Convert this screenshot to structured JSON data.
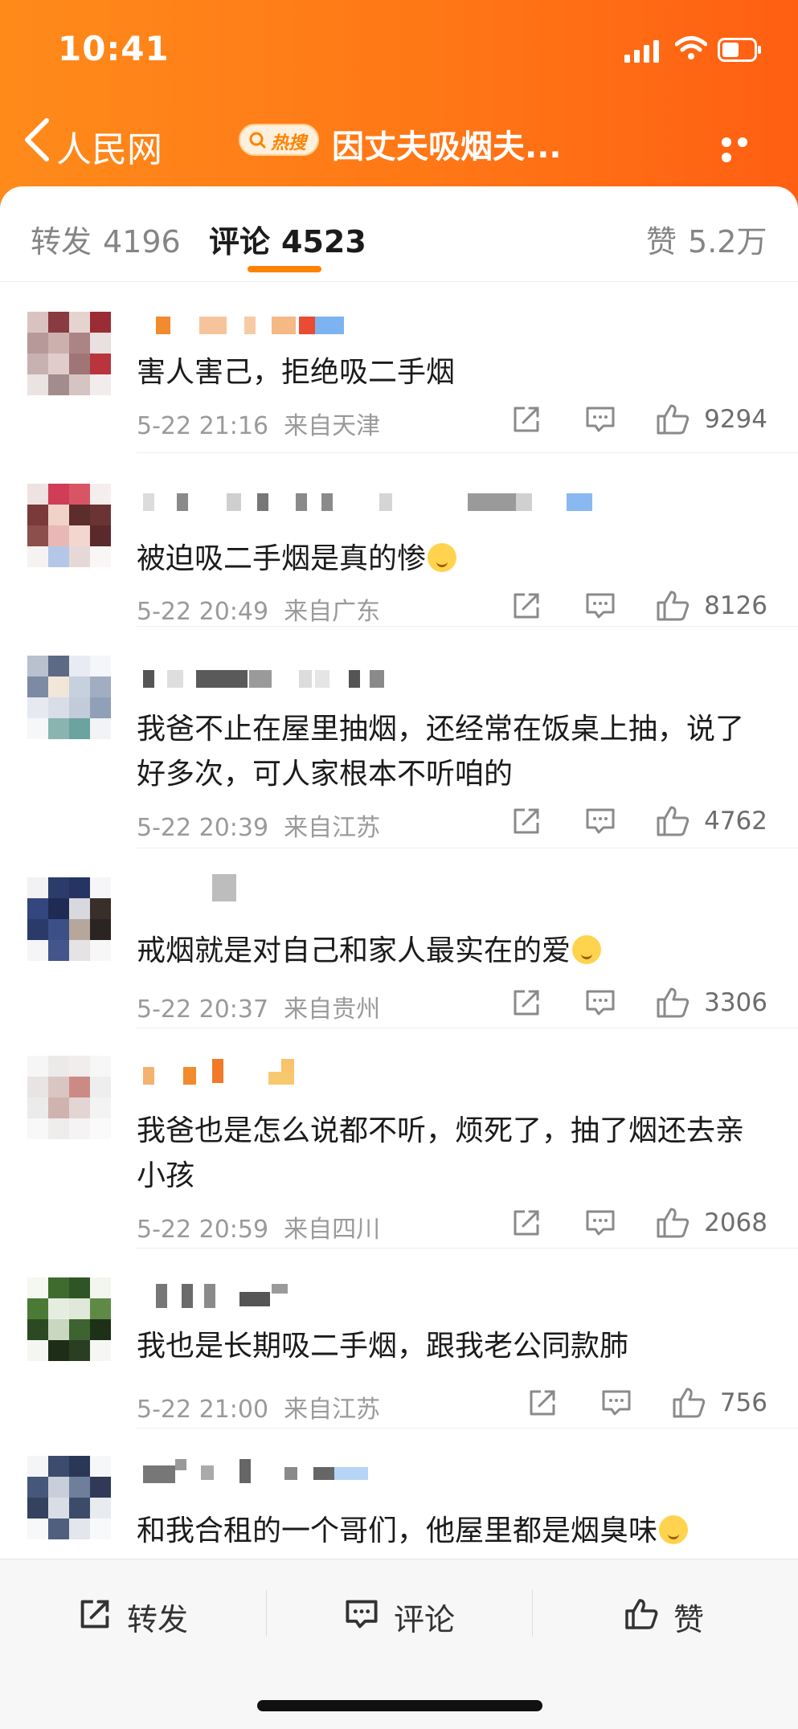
{
  "status": {
    "time": "10:41"
  },
  "nav": {
    "back_label": "人民网",
    "hot_label": "热搜",
    "title": "因丈夫吸烟夫..."
  },
  "tabs": [
    {
      "label": "转发",
      "count": "4196"
    },
    {
      "label": "评论",
      "count": "4523"
    },
    {
      "label": "赞",
      "count": "5.2万"
    }
  ],
  "comments": [
    {
      "text": "害人害己，拒绝吸二手烟",
      "time": "5-22 21:16",
      "location": "来自天津",
      "likes": "9294"
    },
    {
      "text": "被迫吸二手烟是真的惨",
      "emoji": "pensive-face-icon",
      "time": "5-22 20:49",
      "location": "来自广东",
      "likes": "8126"
    },
    {
      "text": "我爸不止在屋里抽烟，还经常在饭桌上抽，说了好多次，可人家根本不听咱的",
      "time": "5-22 20:39",
      "location": "来自江苏",
      "likes": "4762"
    },
    {
      "text": "戒烟就是对自己和家人最实在的爱",
      "emoji": "smile-face-icon",
      "time": "5-22 20:37",
      "location": "来自贵州",
      "likes": "3306"
    },
    {
      "text": "我爸也是怎么说都不听，烦死了，抽了烟还去亲小孩",
      "time": "5-22 20:59",
      "location": "来自四川",
      "likes": "2068"
    },
    {
      "text": "我也是长期吸二手烟，跟我老公同款肺",
      "time": "5-22 21:00",
      "location": "来自江苏",
      "likes": "756"
    },
    {
      "text": "和我合租的一个哥们，他屋里都是烟臭味",
      "emoji": "pensive-face-icon"
    }
  ],
  "bottom_bar": {
    "share": "转发",
    "comment": "评论",
    "like": "赞"
  },
  "colors": {
    "header_start": "#ff8a1a",
    "header_end": "#ff5f12",
    "accent": "#ff8200"
  }
}
